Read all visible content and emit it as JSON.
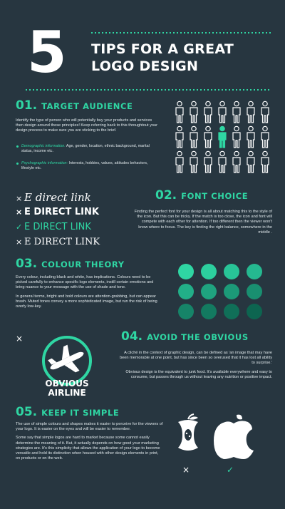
{
  "header": {
    "number": "5",
    "line1": "TIPS FOR A GREAT",
    "line2": "LOGO DESIGN"
  },
  "sec1": {
    "num": "01.",
    "title": "TARGET AUDIENCE",
    "body": "Identify the type of person who will potentially buy your products and services then design around these principles! Keep referring back to this throughtout your design process to make sure you are sticking to the brief.",
    "b1_label": "Demographic information:",
    "b1_text": " Age, gender, location, ethnic background, marital status, income etc.",
    "b2_label": "Psychographic information:",
    "b2_text": " Interests, hobbies, values, attitudes behaviors, lifestyle etc."
  },
  "sec2": {
    "num": "02.",
    "title": "FONT CHOICE",
    "samples": [
      "E direct link",
      "E DIRECT LINK",
      "E DIRECT LINK",
      "E DIRECT LINK"
    ],
    "marks": [
      "×",
      "×",
      "✓",
      "×"
    ],
    "body": "Finding the perfect font for your design is all about matching this to the style of the icon. But this can be tricky. If the match is too close, the icon and font will compete with each other for attention. If too different then the viewer won't know where to focus. The key is finding the right balance, somewhere in the middle ."
  },
  "sec3": {
    "num": "03.",
    "title": "COLOUR THEORY",
    "p1": "Every colour, including black and white, has implications. Colours need to be picked carefully to enhance specific logo elements, instill certain emotions and bring nuance to your message with the use of shade and tone.",
    "p2": "In general terms, bright and bold colours are attention-grabbing, but can appear brash. Muted tones convey a more sophisticated image, but run the risk of being overly low-key.",
    "colors": [
      "#2fd6a3",
      "#2ccf9e",
      "#28c497",
      "#25b990",
      "#22af88",
      "#1fa37f",
      "#1c9a78",
      "#198f70",
      "#168468",
      "#137a60",
      "#106f58",
      "#0d6550"
    ]
  },
  "sec4": {
    "num": "04.",
    "title": "AVOID THE OBVIOUS",
    "mark": "×",
    "logo_line1": "OBVIOUS",
    "logo_line2": "AIRLINE",
    "p1": "A cliché in the context of graphic design, can be defined as  'an image that may have been memorable at one point, but has since been so overused that it has lost all ability to surprise.'",
    "p2": "Obvious design is the equivalent to junk food. It's available everywhere and easy to consume, but passes through us without leaving any nutrition or positive impact."
  },
  "sec5": {
    "num": "05.",
    "title": "KEEP IT SIMPLE",
    "p1": "The use of simple colours and shapes makes it easier to perceive for the viewers of your logo. It is easier on the eyes and will be easier to remember.",
    "p2": "Some say that simple logos are hard to market because some cannot easily determine the meaning of it. But, it actually depends on how good your marketing strategies are. It's this simplicity that allows the application of your logo to become versatile and hold its distinction when housed with other design elements in print, on products or on the web.",
    "mark_bad": "×",
    "mark_good": "✓"
  }
}
